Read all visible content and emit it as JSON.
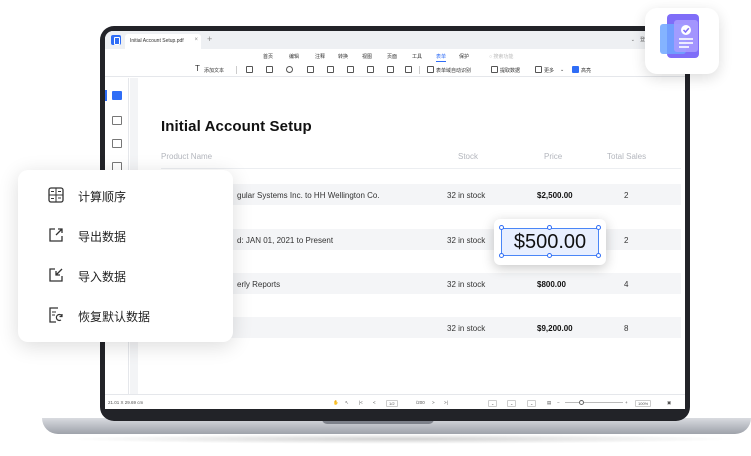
{
  "window": {
    "tab_title": "Initial Account Setup.pdf",
    "tab_close": "×",
    "tab_add": "+",
    "right_items": [
      "⌄",
      "登录",
      "登录"
    ]
  },
  "menu": {
    "items": [
      "首页",
      "编辑",
      "注释",
      "转换",
      "视图",
      "页面",
      "工具",
      "表单",
      "保护"
    ],
    "active": "表单",
    "search_placeholder": "搜索功能"
  },
  "toolbar": {
    "add_text": "添加文本",
    "auto_recognize": "表单域自动识别",
    "extract_data": "提取数据",
    "more": "更多",
    "highlight_fields": "高亮"
  },
  "document": {
    "title": "Initial Account Setup",
    "columns": [
      "Product Name",
      "Stock",
      "Price",
      "Total Sales"
    ],
    "rows": [
      {
        "name": "gular Systems Inc. to HH Wellington Co.",
        "stock": "32 in stock",
        "price": "$2,500.00",
        "sales": "2"
      },
      {
        "name": "d: JAN 01, 2021 to Present",
        "stock": "32 in stock",
        "price": "",
        "sales": "2"
      },
      {
        "name": "erly Reports",
        "stock": "32 in stock",
        "price": "$800.00",
        "sales": "4"
      },
      {
        "name": "",
        "stock": "32 in stock",
        "price": "$9,200.00",
        "sales": "8"
      }
    ]
  },
  "callout": {
    "value": "$500.00"
  },
  "statusbar": {
    "page_size": "21.01 X 29.69 cm",
    "page_current": "1/2",
    "page_total": "/200",
    "zoom": "100%"
  },
  "context_menu": {
    "items": [
      "计算顺序",
      "导出数据",
      "导入数据",
      "恢复默认数据"
    ]
  },
  "colors": {
    "accent": "#2f6df6",
    "row_bg": "#f4f5f7",
    "bezel": "#222328"
  }
}
